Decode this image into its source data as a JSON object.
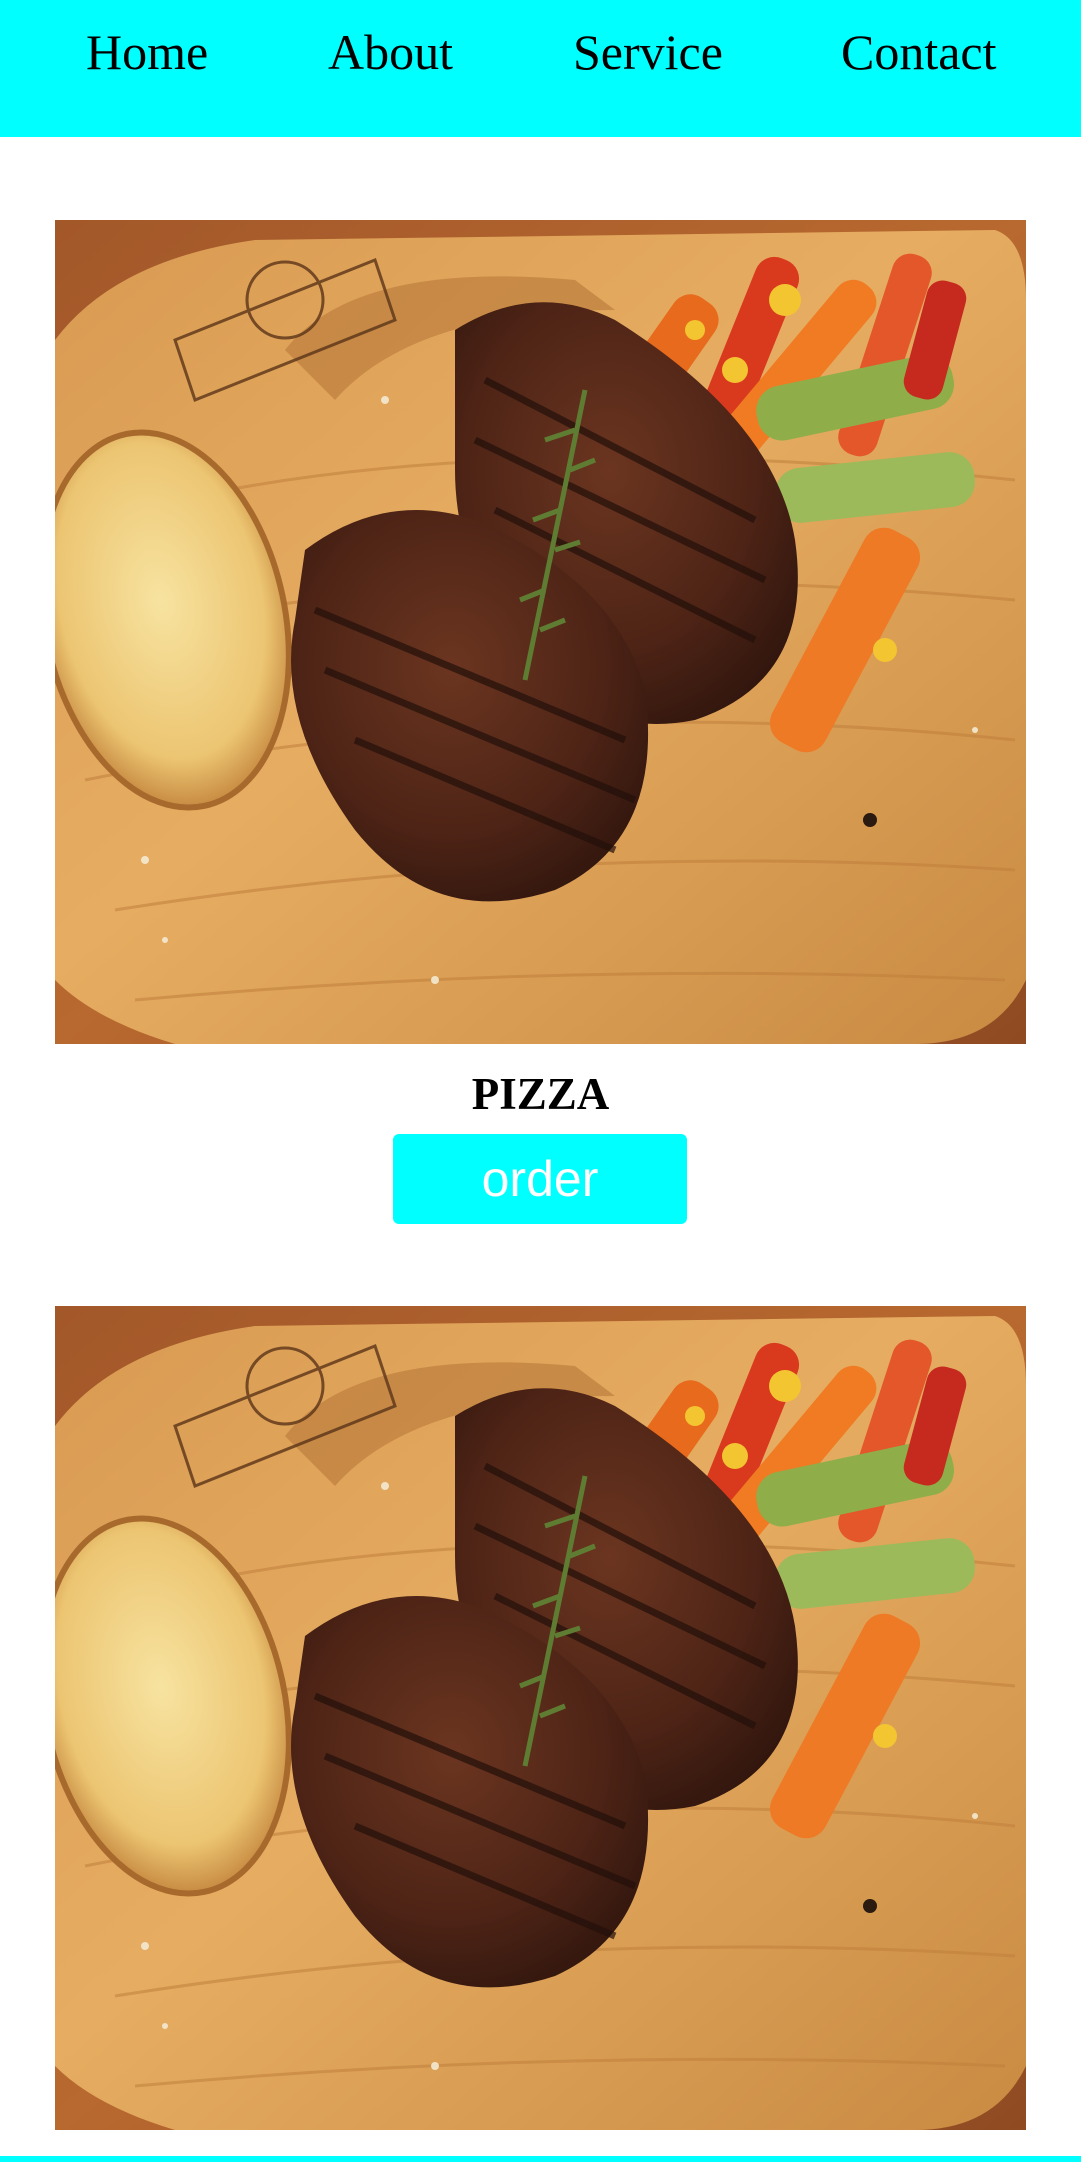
{
  "theme": {
    "accent": "#00ffff",
    "text": "#000000",
    "button_text": "#ffffff",
    "background": "#ffffff"
  },
  "nav": {
    "items": [
      {
        "label": "Home"
      },
      {
        "label": "About"
      },
      {
        "label": "Service"
      },
      {
        "label": "Contact"
      }
    ]
  },
  "cards": [
    {
      "image_icon": "steak-plate-photo",
      "title": "PIZZA",
      "button_label": "order"
    },
    {
      "image_icon": "steak-plate-photo"
    }
  ]
}
